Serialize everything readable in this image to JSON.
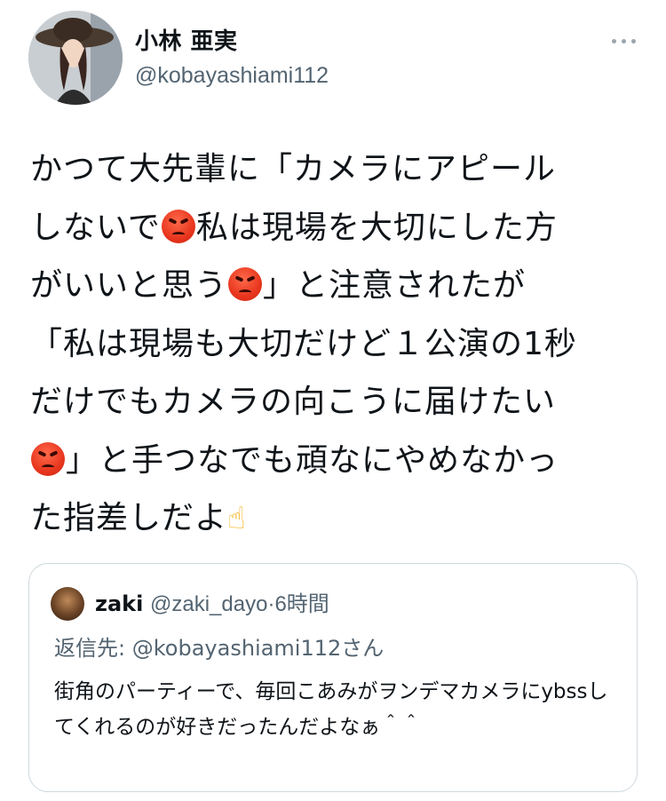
{
  "author": {
    "display_name": "小林 亜実",
    "handle": "@kobayashiami112"
  },
  "tweet": {
    "line1": "かつて大先輩に「カメラにアピール",
    "line2a": "しないで",
    "line2b": "私は現場を大切にした方",
    "line3a": "がいいと思う",
    "line3b": "」と注意されたが",
    "line4": "「私は現場も大切だけど１公演の1秒",
    "line5": "だけでもカメラの向こうに届けたい",
    "line6b": "」と手つなでも頑なにやめなかっ",
    "line7a": "た指差しだよ",
    "emoji_angry": "angry-face-icon",
    "emoji_point": "pointing-up-hand-icon"
  },
  "quote": {
    "name": "zaki",
    "handle": "@zaki_dayo",
    "separator": "·",
    "time": "6時間",
    "reply_prefix": "返信先:",
    "reply_mention": "@kobayashiami112",
    "reply_suffix": "さん",
    "body": "街角のパーティーで、毎回こあみがヲンデマカメラにybssしてくれるのが好きだったんだよなぁ＾＾"
  },
  "colors": {
    "text": "#0f1419",
    "secondary": "#536471",
    "border": "#cfd9de"
  }
}
